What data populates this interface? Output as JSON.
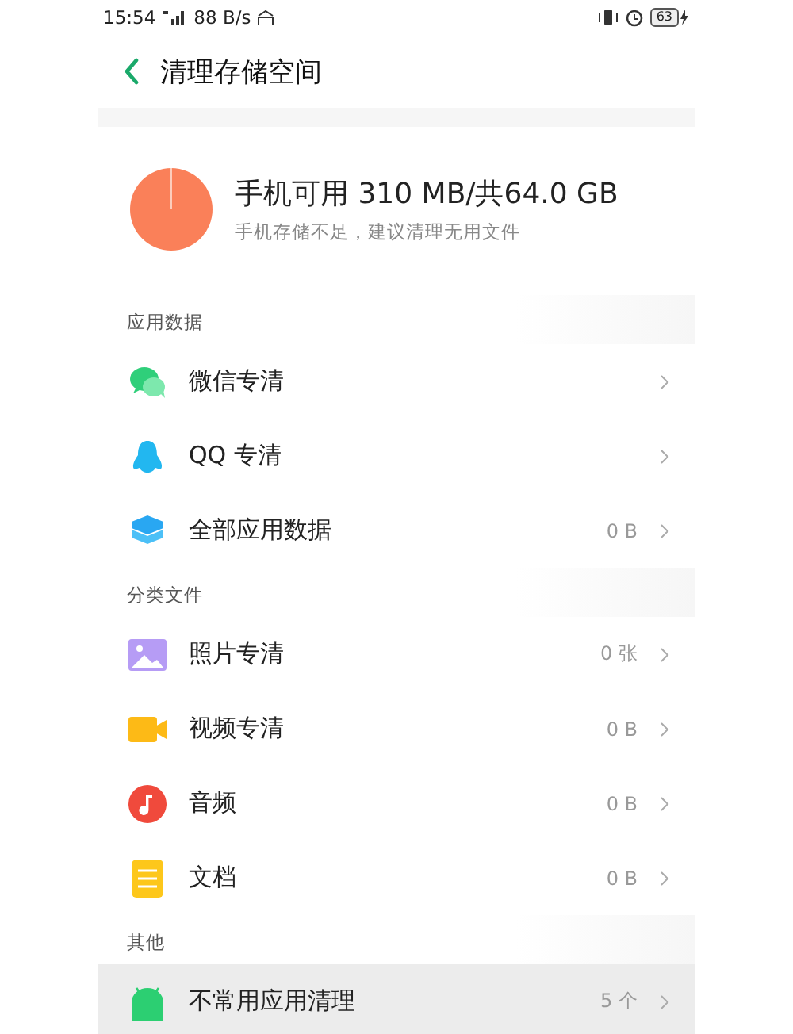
{
  "status_bar": {
    "time": "15:54",
    "speed": "88 B/s",
    "battery": "63"
  },
  "header": {
    "title": "清理存储空间"
  },
  "storage": {
    "title": "手机可用 310 MB/共64.0 GB",
    "subtitle": "手机存储不足，建议清理无用文件"
  },
  "sections": [
    {
      "title": "应用数据",
      "rows": [
        {
          "kind": "wechat",
          "label": "微信专清",
          "selected": false
        },
        {
          "kind": "qq",
          "label": "QQ 专清",
          "selected": false
        },
        {
          "kind": "apps",
          "label": "全部应用数据",
          "value": "0 B",
          "selected": false
        }
      ]
    },
    {
      "title": "分类文件",
      "rows": [
        {
          "kind": "photo",
          "label": "照片专清",
          "value": "0 张",
          "selected": false
        },
        {
          "kind": "video",
          "label": "视频专清",
          "value": "0 B",
          "selected": false
        },
        {
          "kind": "audio",
          "label": "音频",
          "value": "0 B",
          "selected": false
        },
        {
          "kind": "document",
          "label": "文档",
          "value": "0 B",
          "selected": false
        }
      ]
    },
    {
      "title": "其他",
      "rows": [
        {
          "kind": "android",
          "label": "不常用应用清理",
          "value": "5 个",
          "selected": true
        }
      ]
    }
  ]
}
